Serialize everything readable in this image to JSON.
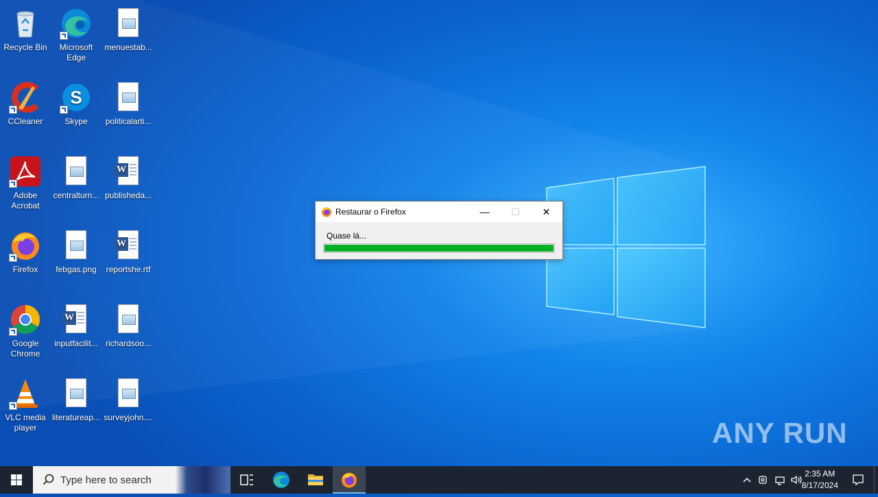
{
  "desktop": {
    "icons": [
      {
        "label": "Recycle Bin"
      },
      {
        "label": "Microsoft Edge"
      },
      {
        "label": "menuestab..."
      },
      {
        "label": "CCleaner"
      },
      {
        "label": "Skype"
      },
      {
        "label": "politicalarti..."
      },
      {
        "label": "Adobe Acrobat"
      },
      {
        "label": "centralturn..."
      },
      {
        "label": "publisheda..."
      },
      {
        "label": "Firefox"
      },
      {
        "label": "febgas.png"
      },
      {
        "label": "reportshe.rtf"
      },
      {
        "label": "Google Chrome"
      },
      {
        "label": "inputfacilit..."
      },
      {
        "label": "richardsoo..."
      },
      {
        "label": "VLC media player"
      },
      {
        "label": "literatureap..."
      },
      {
        "label": "surveyjohn...."
      }
    ]
  },
  "dialog": {
    "title": "Restaurar o Firefox",
    "message": "Quase lá...",
    "progress": 1.0,
    "minimize": "—",
    "maximize": "☐",
    "close": "✕"
  },
  "taskbar": {
    "search_placeholder": "Type here to search",
    "time": "2:35 AM",
    "date": "8/17/2024"
  },
  "watermark": "ANY RUN",
  "colors": {
    "progress_fill": "#06b025",
    "taskbar": "#1b2430"
  }
}
